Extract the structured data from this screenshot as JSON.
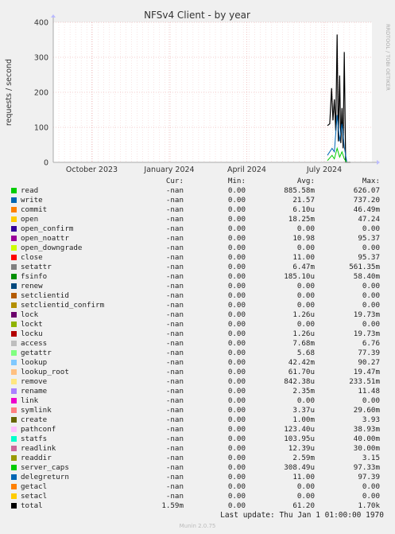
{
  "chart_data": {
    "type": "area",
    "title": "NFSv4 Client - by year",
    "ylabel": "requests / second",
    "ylim": [
      0,
      400
    ],
    "yticks": [
      "0",
      "100",
      "200",
      "300",
      "400"
    ],
    "xticks": [
      "October 2023",
      "January 2024",
      "April 2024",
      "July 2024"
    ],
    "grid": true,
    "side_label": "RRDTOOL / TOBI OETIKER",
    "series": [
      {
        "name": "total",
        "color": "#000000",
        "x": [
          0.0,
          0.1,
          0.18,
          0.24,
          0.3,
          0.36,
          0.42,
          0.47,
          0.53,
          0.58,
          0.63,
          0.68,
          0.73,
          0.79,
          0.84,
          0.89,
          0.95,
          1.0
        ],
        "y": [
          105,
          110,
          212,
          120,
          180,
          90,
          365,
          60,
          248,
          55,
          155,
          40,
          315,
          0,
          0,
          0,
          0,
          0
        ]
      },
      {
        "name": "write",
        "color": "#0066b3",
        "x": [
          0.0,
          0.2,
          0.3,
          0.42,
          0.53,
          0.63,
          0.73,
          0.84,
          1.0
        ],
        "y": [
          20,
          40,
          30,
          135,
          60,
          110,
          45,
          0,
          0
        ]
      },
      {
        "name": "read",
        "color": "#00cc00",
        "x": [
          0.0,
          0.2,
          0.3,
          0.42,
          0.53,
          0.63,
          0.73,
          0.84,
          1.0
        ],
        "y": [
          5,
          20,
          10,
          40,
          15,
          30,
          10,
          0,
          0
        ]
      }
    ]
  },
  "legend": {
    "headers": {
      "cur": "Cur:",
      "min": "Min:",
      "avg": "Avg:",
      "max": "Max:"
    },
    "rows": [
      {
        "name": "read",
        "color": "#00cc00",
        "cur": "-nan",
        "min": "0.00",
        "avg": "885.58m",
        "max": "626.07"
      },
      {
        "name": "write",
        "color": "#0066b3",
        "cur": "-nan",
        "min": "0.00",
        "avg": "21.57",
        "max": "737.20"
      },
      {
        "name": "commit",
        "color": "#ff8000",
        "cur": "-nan",
        "min": "0.00",
        "avg": "6.10u",
        "max": "46.49m"
      },
      {
        "name": "open",
        "color": "#ffcc00",
        "cur": "-nan",
        "min": "0.00",
        "avg": "18.25m",
        "max": "47.24"
      },
      {
        "name": "open_confirm",
        "color": "#330099",
        "cur": "-nan",
        "min": "0.00",
        "avg": "0.00",
        "max": "0.00"
      },
      {
        "name": "open_noattr",
        "color": "#990099",
        "cur": "-nan",
        "min": "0.00",
        "avg": "10.98",
        "max": "95.37"
      },
      {
        "name": "open_downgrade",
        "color": "#ccff00",
        "cur": "-nan",
        "min": "0.00",
        "avg": "0.00",
        "max": "0.00"
      },
      {
        "name": "close",
        "color": "#ff0000",
        "cur": "-nan",
        "min": "0.00",
        "avg": "11.00",
        "max": "95.37"
      },
      {
        "name": "setattr",
        "color": "#808080",
        "cur": "-nan",
        "min": "0.00",
        "avg": "6.47m",
        "max": "561.35m"
      },
      {
        "name": "fsinfo",
        "color": "#008f00",
        "cur": "-nan",
        "min": "0.00",
        "avg": "185.10u",
        "max": "58.40m"
      },
      {
        "name": "renew",
        "color": "#00487d",
        "cur": "-nan",
        "min": "0.00",
        "avg": "0.00",
        "max": "0.00"
      },
      {
        "name": "setclientid",
        "color": "#b35a00",
        "cur": "-nan",
        "min": "0.00",
        "avg": "0.00",
        "max": "0.00"
      },
      {
        "name": "setclientid_confirm",
        "color": "#b38f00",
        "cur": "-nan",
        "min": "0.00",
        "avg": "0.00",
        "max": "0.00"
      },
      {
        "name": "lock",
        "color": "#6b006b",
        "cur": "-nan",
        "min": "0.00",
        "avg": "1.26u",
        "max": "19.73m"
      },
      {
        "name": "lockt",
        "color": "#8fb300",
        "cur": "-nan",
        "min": "0.00",
        "avg": "0.00",
        "max": "0.00"
      },
      {
        "name": "locku",
        "color": "#b30000",
        "cur": "-nan",
        "min": "0.00",
        "avg": "1.26u",
        "max": "19.73m"
      },
      {
        "name": "access",
        "color": "#bebebe",
        "cur": "-nan",
        "min": "0.00",
        "avg": "7.68m",
        "max": "6.76"
      },
      {
        "name": "getattr",
        "color": "#80ff80",
        "cur": "-nan",
        "min": "0.00",
        "avg": "5.68",
        "max": "77.39"
      },
      {
        "name": "lookup",
        "color": "#80c9ff",
        "cur": "-nan",
        "min": "0.00",
        "avg": "42.42m",
        "max": "90.27"
      },
      {
        "name": "lookup_root",
        "color": "#ffc080",
        "cur": "-nan",
        "min": "0.00",
        "avg": "61.70u",
        "max": "19.47m"
      },
      {
        "name": "remove",
        "color": "#ffe680",
        "cur": "-nan",
        "min": "0.00",
        "avg": "842.38u",
        "max": "233.51m"
      },
      {
        "name": "rename",
        "color": "#aa80ff",
        "cur": "-nan",
        "min": "0.00",
        "avg": "2.35m",
        "max": "11.48"
      },
      {
        "name": "link",
        "color": "#ee00cc",
        "cur": "-nan",
        "min": "0.00",
        "avg": "0.00",
        "max": "0.00"
      },
      {
        "name": "symlink",
        "color": "#ff8080",
        "cur": "-nan",
        "min": "0.00",
        "avg": "3.37u",
        "max": "29.60m"
      },
      {
        "name": "create",
        "color": "#666600",
        "cur": "-nan",
        "min": "0.00",
        "avg": "1.00m",
        "max": "3.93"
      },
      {
        "name": "pathconf",
        "color": "#ffbfff",
        "cur": "-nan",
        "min": "0.00",
        "avg": "123.40u",
        "max": "38.93m"
      },
      {
        "name": "statfs",
        "color": "#00ffcc",
        "cur": "-nan",
        "min": "0.00",
        "avg": "103.95u",
        "max": "40.00m"
      },
      {
        "name": "readlink",
        "color": "#cc6699",
        "cur": "-nan",
        "min": "0.00",
        "avg": "12.39u",
        "max": "30.00m"
      },
      {
        "name": "readdir",
        "color": "#999900",
        "cur": "-nan",
        "min": "0.00",
        "avg": "2.59m",
        "max": "3.15"
      },
      {
        "name": "server_caps",
        "color": "#00cc00",
        "cur": "-nan",
        "min": "0.00",
        "avg": "308.49u",
        "max": "97.33m"
      },
      {
        "name": "delegreturn",
        "color": "#0066b3",
        "cur": "-nan",
        "min": "0.00",
        "avg": "11.00",
        "max": "97.39"
      },
      {
        "name": "getacl",
        "color": "#ff8000",
        "cur": "-nan",
        "min": "0.00",
        "avg": "0.00",
        "max": "0.00"
      },
      {
        "name": "setacl",
        "color": "#ffcc00",
        "cur": "-nan",
        "min": "0.00",
        "avg": "0.00",
        "max": "0.00"
      },
      {
        "name": "total",
        "color": "#000000",
        "cur": "1.59m",
        "min": "0.00",
        "avg": "61.20",
        "max": "1.70k"
      }
    ]
  },
  "footer": {
    "last_update": "Last update: Thu Jan  1 01:00:00 1970",
    "munin": "Munin 2.0.75"
  }
}
